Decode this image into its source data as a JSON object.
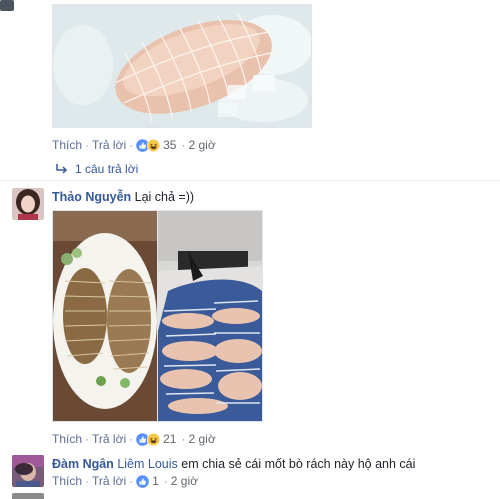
{
  "comment1": {
    "actions": {
      "like": "Thích",
      "reply": "Trả lời",
      "reaction_count": "35",
      "time": "2 giờ"
    },
    "replies_link": "1 câu trả lời"
  },
  "comment2": {
    "author": "Thảo Nguyễn",
    "text": "Lại chả =))",
    "actions": {
      "like": "Thích",
      "reply": "Trả lời",
      "reaction_count": "21",
      "time": "2 giờ"
    }
  },
  "comment3": {
    "author": "Đàm Ngân",
    "mention": "Liêm Louis",
    "text": "em chia sẻ cái mốt bò rách này hộ anh cái",
    "actions": {
      "like": "Thích",
      "reply": "Trả lời",
      "reaction_count": "1",
      "time": "2 giờ"
    }
  },
  "separator": "·",
  "icons": [
    "like-reaction-icon",
    "haha-reaction-icon",
    "reply-arrow-icon"
  ],
  "colors": {
    "link": "#365899",
    "action": "#5b6d95",
    "meta": "#616770",
    "like_blue": "#5890ff",
    "haha_yellow": "#f7c948"
  }
}
